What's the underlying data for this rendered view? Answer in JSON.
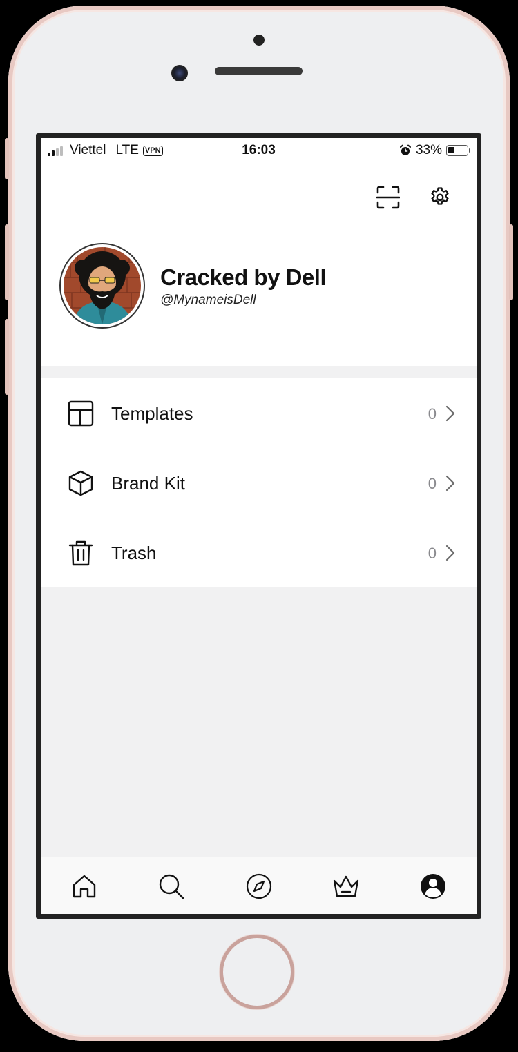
{
  "status_bar": {
    "carrier": "Viettel",
    "network": "LTE",
    "vpn": "VPN",
    "time": "16:03",
    "battery": "33%",
    "battery_level": 0.33
  },
  "header": {
    "scan_icon": "scan-icon",
    "settings_icon": "gear-icon"
  },
  "profile": {
    "name": "Cracked by Dell",
    "handle": "@MynameisDell"
  },
  "menu": {
    "items": [
      {
        "label": "Templates",
        "count": "0",
        "icon": "template-icon"
      },
      {
        "label": "Brand Kit",
        "count": "0",
        "icon": "box-icon"
      },
      {
        "label": "Trash",
        "count": "0",
        "icon": "trash-icon"
      }
    ]
  },
  "tabbar": {
    "tabs": [
      "home-icon",
      "search-icon",
      "compass-icon",
      "crown-icon",
      "profile-icon"
    ],
    "active": "profile-icon"
  }
}
